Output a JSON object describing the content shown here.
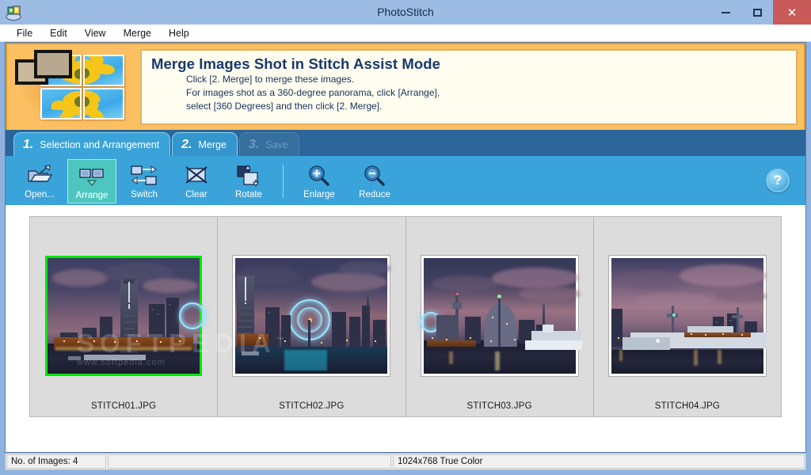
{
  "window": {
    "title": "PhotoStitch",
    "app_icon": "photostitch-app-icon",
    "minimize_label": "",
    "maximize_label": "",
    "close_label": "✕"
  },
  "menubar": {
    "items": [
      {
        "label": "File"
      },
      {
        "label": "Edit"
      },
      {
        "label": "View"
      },
      {
        "label": "Merge"
      },
      {
        "label": "Help"
      }
    ]
  },
  "banner": {
    "icon": "four-panel-sunflower-icon",
    "heading": "Merge Images Shot in Stitch Assist Mode",
    "lines": [
      "Click [2.  Merge] to merge these images.",
      "For images shot as a 360-degree panorama, click [Arrange],",
      "select [360 Degrees] and then click [2. Merge]."
    ]
  },
  "tabs": [
    {
      "num": "1.",
      "label": "Selection and Arrangement",
      "state": "active"
    },
    {
      "num": "2.",
      "label": "Merge",
      "state": "normal"
    },
    {
      "num": "3.",
      "label": "Save",
      "state": "disabled"
    }
  ],
  "toolbar": {
    "buttons": [
      {
        "label": "Open...",
        "icon": "open-folder-icon",
        "state": "normal"
      },
      {
        "label": "Arrange",
        "icon": "arrange-icon",
        "state": "pressed"
      },
      {
        "label": "Switch",
        "icon": "switch-icon",
        "state": "normal"
      },
      {
        "label": "Clear",
        "icon": "clear-x-icon",
        "state": "normal"
      },
      {
        "label": "Rotate",
        "icon": "rotate-icon",
        "state": "normal"
      },
      {
        "label": "Enlarge",
        "icon": "zoom-in-icon",
        "state": "normal"
      },
      {
        "label": "Reduce",
        "icon": "zoom-out-icon",
        "state": "normal"
      }
    ],
    "help": {
      "label": "?",
      "icon": "help-question-icon"
    }
  },
  "watermark": {
    "main": "SOFTPEDIA",
    "trademark": "™",
    "sub": "www.softpedia.com"
  },
  "filmstrip": {
    "images": [
      {
        "filename": "STITCH01.JPG",
        "selected": true,
        "scene": "skyline-landmark-tower"
      },
      {
        "filename": "STITCH02.JPG",
        "selected": false,
        "scene": "ferris-wheel"
      },
      {
        "filename": "STITCH03.JPG",
        "selected": false,
        "scene": "dome-building-and-ship"
      },
      {
        "filename": "STITCH04.JPG",
        "selected": false,
        "scene": "harbor-ship"
      }
    ]
  },
  "statusbar": {
    "count_text": "No. of Images: 4",
    "middle_text": "",
    "display_text": "1024x768 True Color"
  },
  "colors": {
    "title_bar": "#9cbce4",
    "close_button": "#c85a5a",
    "banner_bg": "#fcc063",
    "banner_border": "#d79b34",
    "banner_panel": "#fffdf0",
    "heading_text": "#17386e",
    "tabstrip_bg": "#2b6599",
    "toolbar_bg": "#3aa3d9",
    "pressed_button": "#4dc6c0",
    "selection_border": "#00e800",
    "filmstrip_bg": "#dcdcdc"
  }
}
